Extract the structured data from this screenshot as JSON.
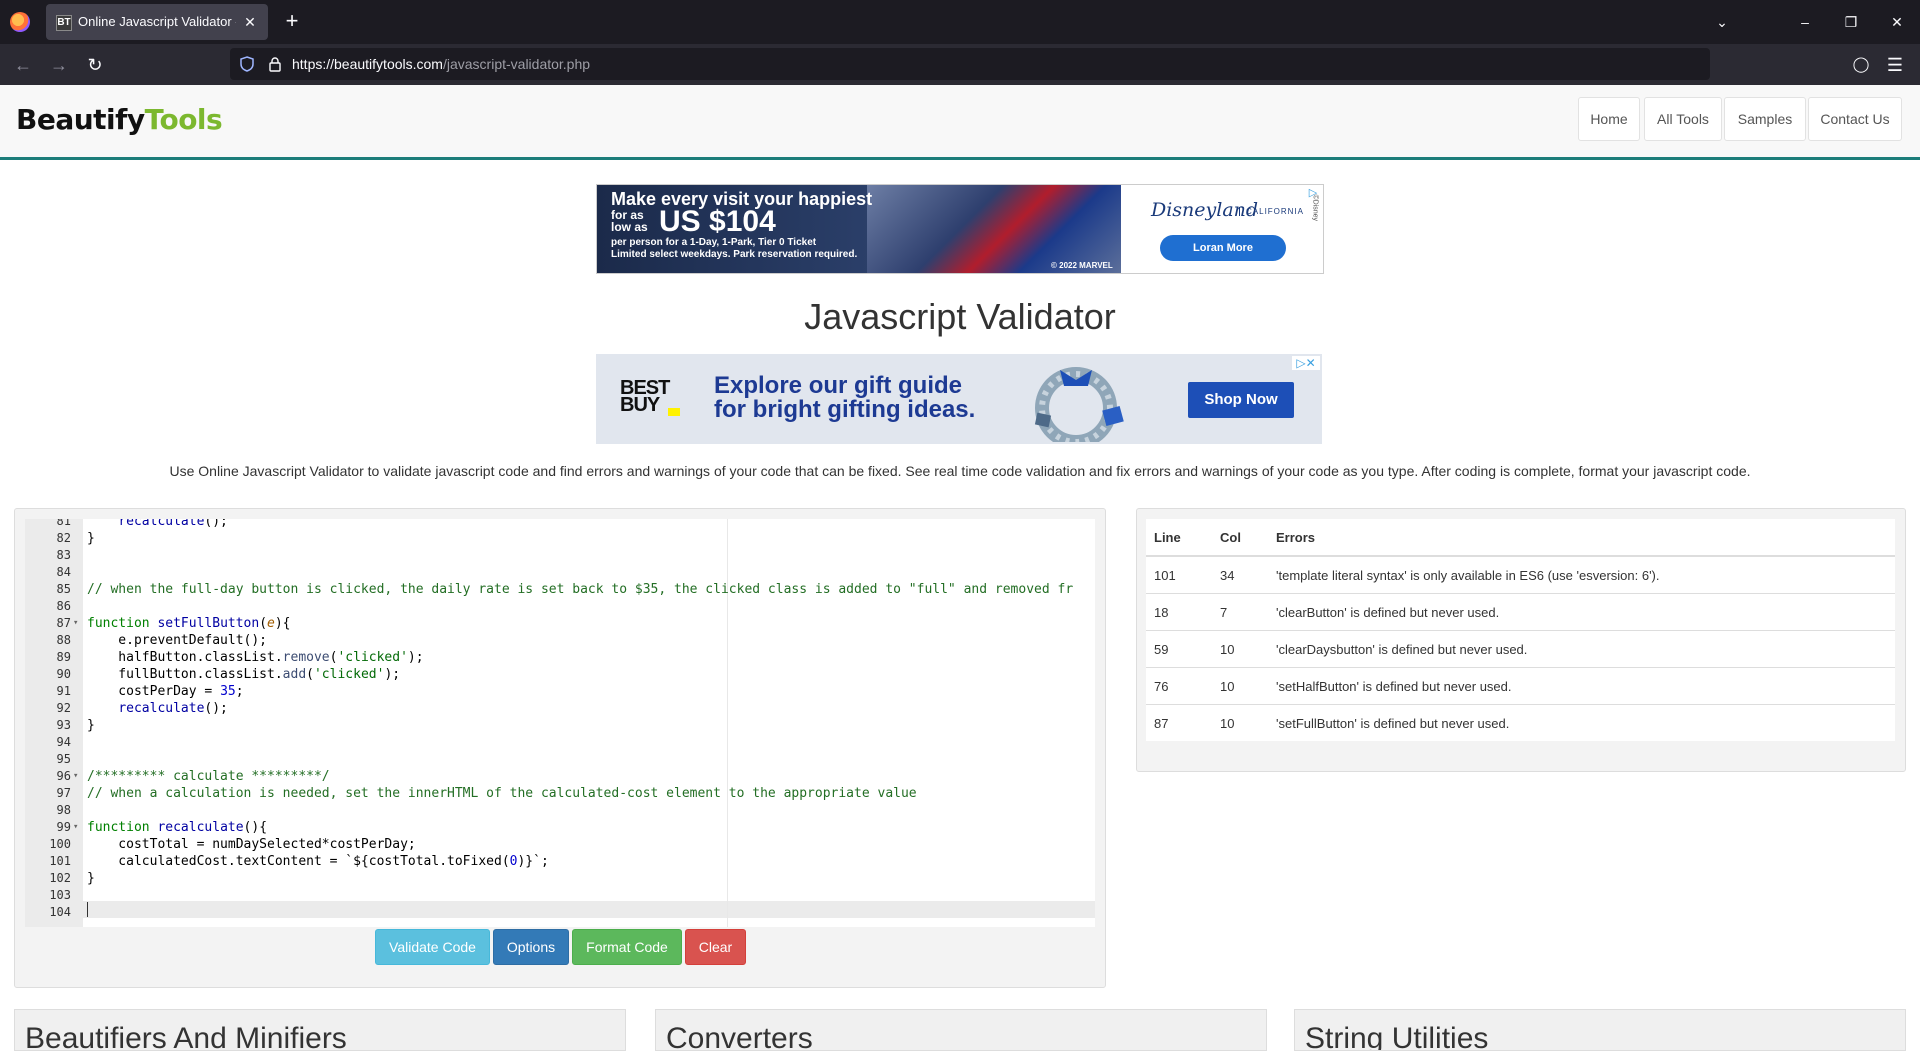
{
  "browser": {
    "tab_title": "Online Javascript Validator - Be",
    "tab_favicon": "BT",
    "url_host": "https://beautifytools.com",
    "url_path": "/javascript-validator.php"
  },
  "site": {
    "logo_part1": "Beautify",
    "logo_part2": "Tools",
    "nav": [
      "Home",
      "All Tools",
      "Samples",
      "Contact Us"
    ],
    "accent_color": "#1c7d7a",
    "brand_green": "#7cb82f"
  },
  "ad1": {
    "headline": "Make every visit your happiest",
    "for_as_low_as": "for as low as",
    "price": "US $104",
    "fine1": "per person for a 1-Day, 1-Park, Tier 0 Ticket",
    "fine2": "Limited select weekdays. Park reservation required.",
    "copyright": "© 2022 MARVEL",
    "brand": "Disneyland",
    "region": "CALIFORNIA",
    "cta": "Loran More",
    "side": "©Disney"
  },
  "page_title": "Javascript Validator",
  "ad2": {
    "logo": "BEST BUY",
    "line1": "Explore our gift guide",
    "line2": "for bright gifting ideas.",
    "cta": "Shop Now"
  },
  "description": "Use Online Javascript Validator to validate javascript code and find errors and warnings of your code that can be fixed. See real time code validation and fix errors and warnings of your code as you type. After coding is complete, format your javascript code.",
  "editor": {
    "lines": [
      {
        "n": "81",
        "text": "    recalculate();"
      },
      {
        "n": "82",
        "text": "}"
      },
      {
        "n": "83",
        "text": ""
      },
      {
        "n": "84",
        "text": ""
      },
      {
        "n": "85",
        "text": "// when the full-day button is clicked, the daily rate is set back to $35, the clicked class is added to \"full\" and removed fr"
      },
      {
        "n": "86",
        "text": ""
      },
      {
        "n": "87",
        "text": "function setFullButton(e){",
        "fold": true
      },
      {
        "n": "88",
        "text": "    e.preventDefault();"
      },
      {
        "n": "89",
        "text": "    halfButton.classList.remove('clicked');"
      },
      {
        "n": "90",
        "text": "    fullButton.classList.add('clicked');"
      },
      {
        "n": "91",
        "text": "    costPerDay = 35;"
      },
      {
        "n": "92",
        "text": "    recalculate();"
      },
      {
        "n": "93",
        "text": "}"
      },
      {
        "n": "94",
        "text": ""
      },
      {
        "n": "95",
        "text": ""
      },
      {
        "n": "96",
        "text": "/********* calculate *********/",
        "fold": true
      },
      {
        "n": "97",
        "text": "// when a calculation is needed, set the innerHTML of the calculated-cost element to the appropriate value"
      },
      {
        "n": "98",
        "text": ""
      },
      {
        "n": "99",
        "text": "function recalculate(){",
        "fold": true
      },
      {
        "n": "100",
        "text": "    costTotal = numDaySelected*costPerDay;"
      },
      {
        "n": "101",
        "text": "    calculatedCost.textContent = `${costTotal.toFixed(0)}`;"
      },
      {
        "n": "102",
        "text": "}"
      },
      {
        "n": "103",
        "text": ""
      },
      {
        "n": "104",
        "text": ""
      }
    ]
  },
  "buttons": {
    "validate": "Validate Code",
    "options": "Options",
    "format": "Format Code",
    "clear": "Clear"
  },
  "errors": {
    "headers": [
      "Line",
      "Col",
      "Errors"
    ],
    "rows": [
      [
        "101",
        "34",
        "'template literal syntax' is only available in ES6 (use 'esversion: 6')."
      ],
      [
        "18",
        "7",
        "'clearButton' is defined but never used."
      ],
      [
        "59",
        "10",
        "'clearDaysbutton' is defined but never used."
      ],
      [
        "76",
        "10",
        "'setHalfButton' is defined but never used."
      ],
      [
        "87",
        "10",
        "'setFullButton' is defined but never used."
      ]
    ]
  },
  "cards": [
    "Beautifiers And Minifiers",
    "Converters",
    "String Utilities"
  ]
}
